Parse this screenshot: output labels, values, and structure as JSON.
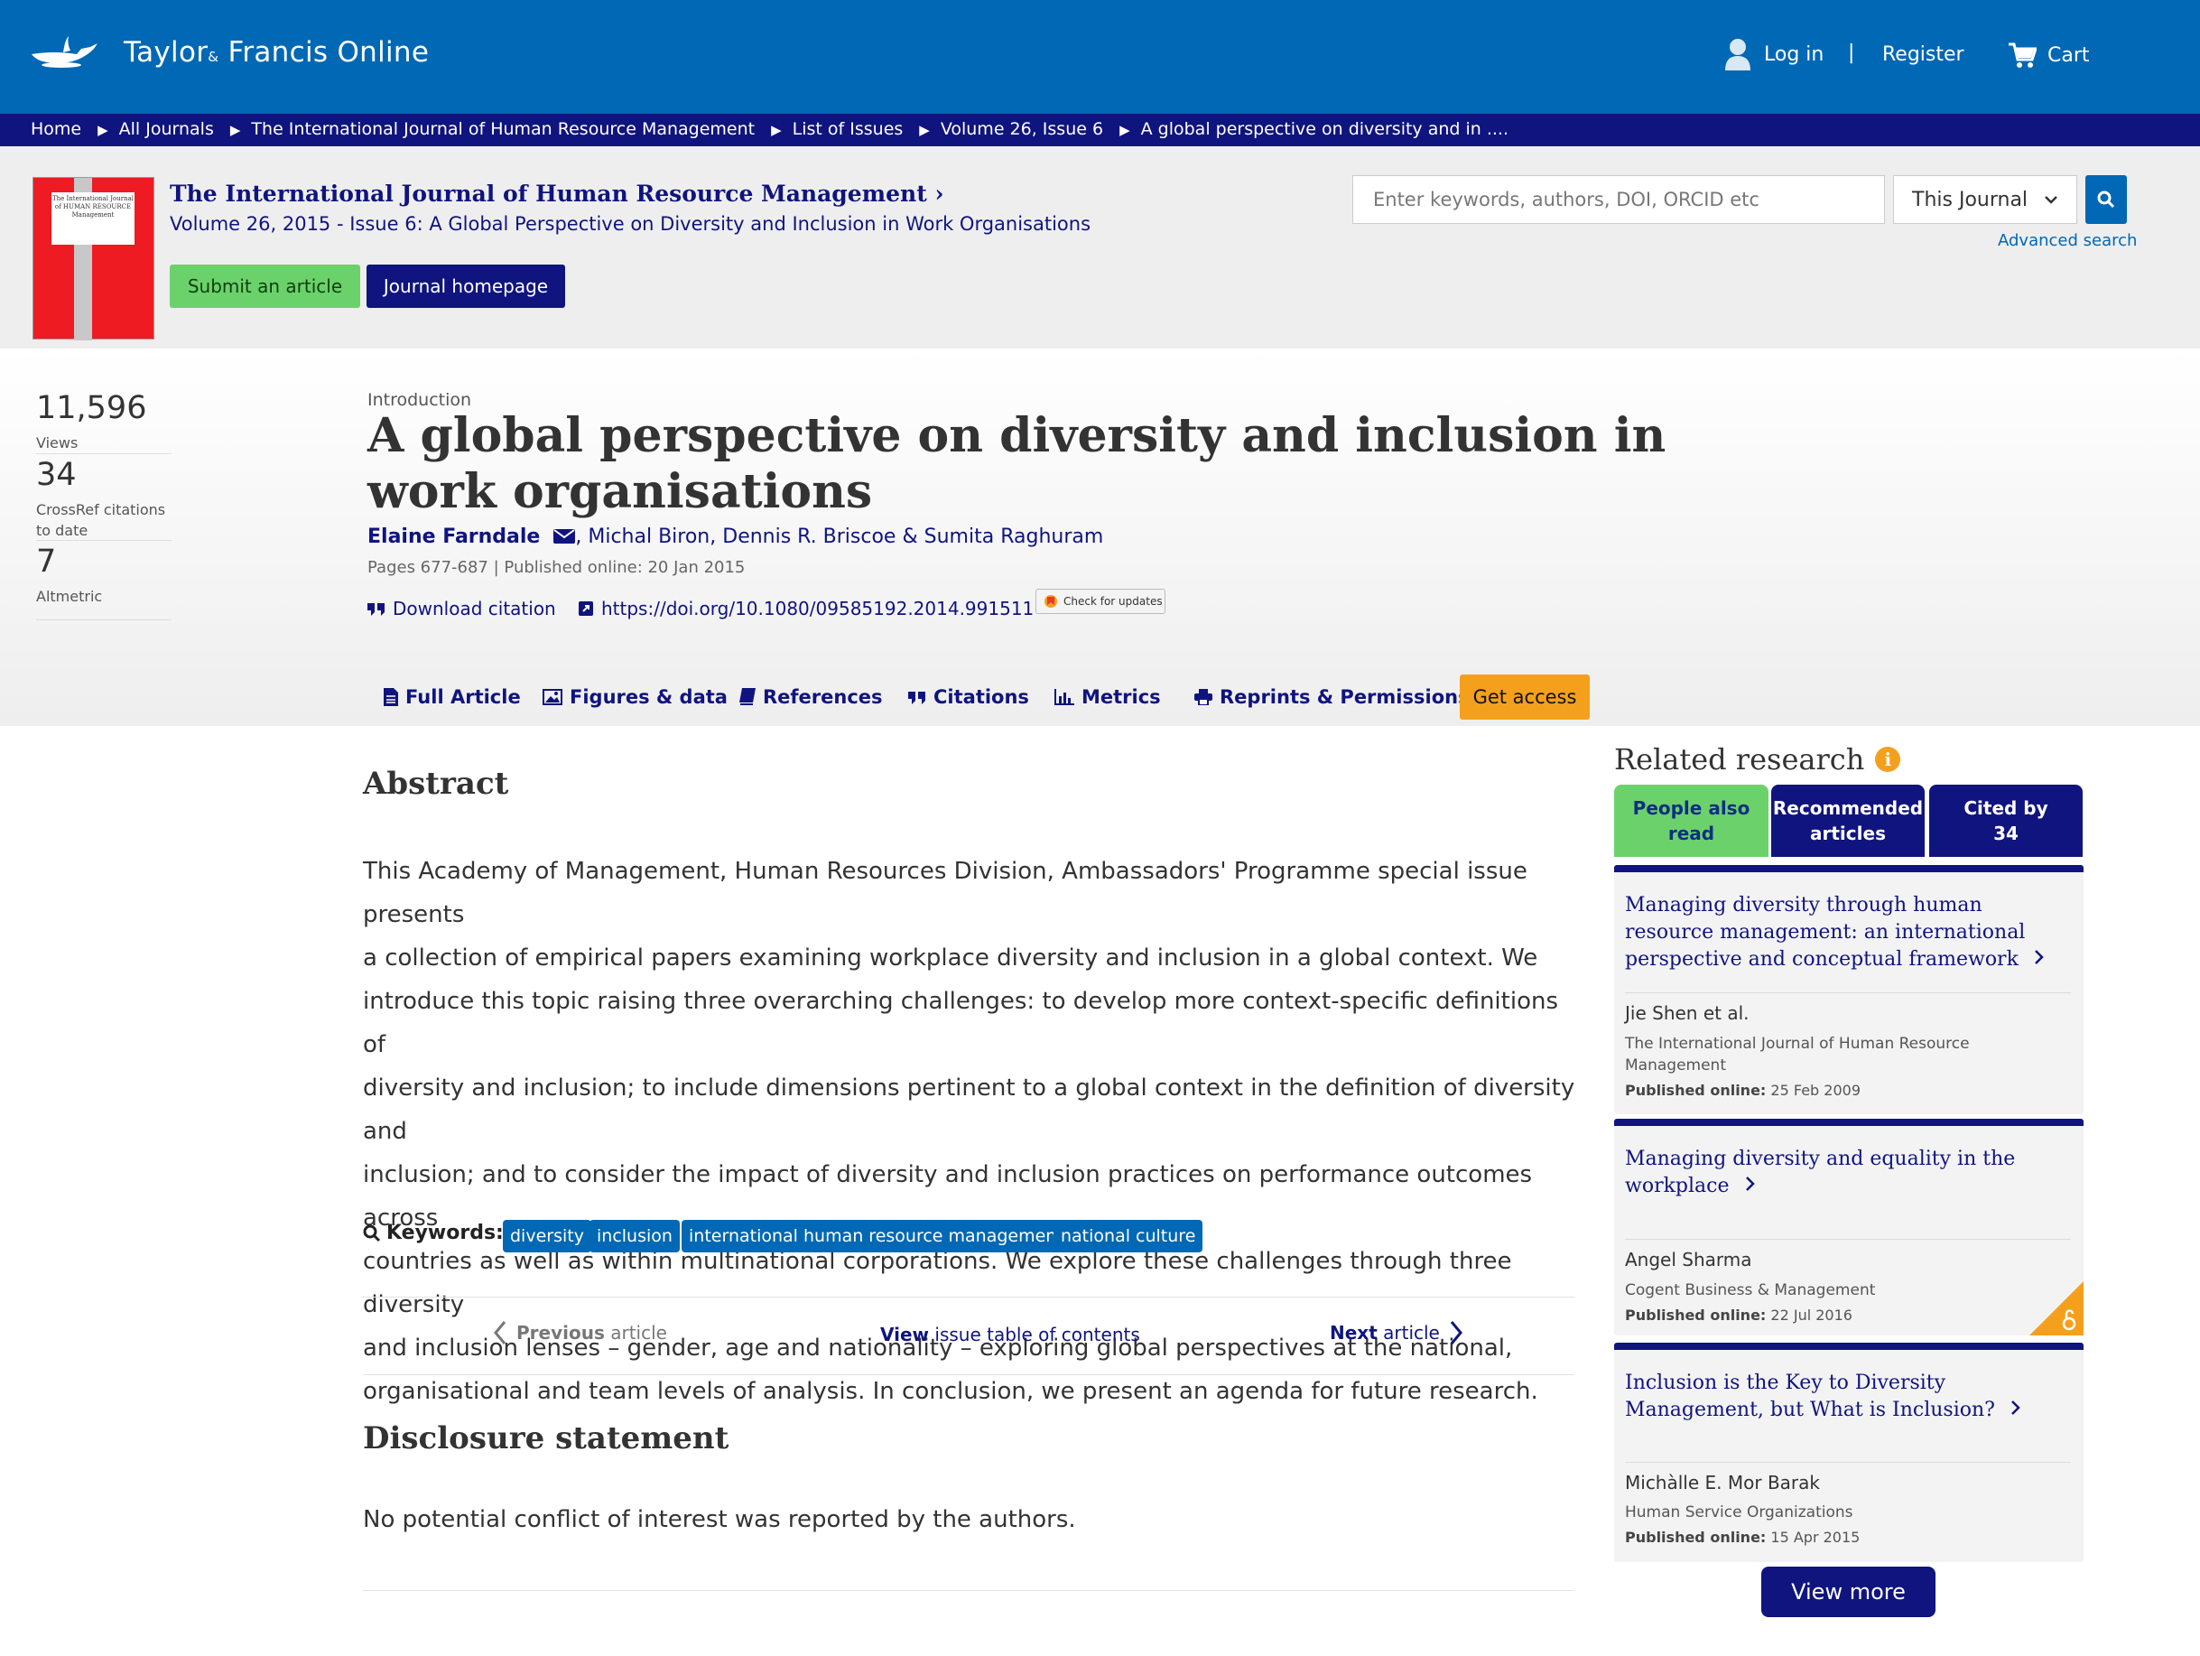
{
  "header": {
    "logo_text": "Taylor",
    "logo_amp": "&",
    "logo_text2": "Francis Online",
    "login": "Log in",
    "divider": "|",
    "register": "Register",
    "cart": "Cart"
  },
  "breadcrumb": {
    "items": [
      "Home",
      "All Journals",
      "The International Journal of Human Resource Management",
      "List of Issues",
      "Volume 26, Issue 6",
      "A global perspective on diversity and in ...."
    ]
  },
  "journal": {
    "title": "The International Journal of Human Resource Management",
    "title_arrow": "›",
    "volume": "Volume 26, 2015 - ",
    "issue_link": "Issue 6: A Global Perspective on Diversity and Inclusion in Work Organisations",
    "submit_label": "Submit an article",
    "homepage_label": "Journal homepage",
    "cover_text": "The International Journal of HUMAN RESOURCE Management"
  },
  "search": {
    "placeholder": "Enter keywords, authors, DOI, ORCID etc",
    "scope": "This Journal",
    "advanced": "Advanced search"
  },
  "metrics": {
    "views_value": "11,596",
    "views_label": "Views",
    "citations_value": "34",
    "citations_label_1": "CrossRef citations",
    "citations_label_2": "to date",
    "altmetric_value": "7",
    "altmetric_label": "Altmetric"
  },
  "article": {
    "type": "Introduction",
    "title": "A global perspective on diversity and inclusion in work organisations",
    "author1": "Elaine Farndale",
    "author_sep1": ", ",
    "author2": "Michal Biron",
    "author_sep2": ", ",
    "author3": "Dennis R. Briscoe",
    "author_sep3": " & ",
    "author4": "Sumita Raghuram",
    "pages": "Pages 677-687",
    "pub_sep": " | ",
    "published": "Published online: 20 Jan 2015",
    "download_citation": "Download citation",
    "doi": "https://doi.org/10.1080/09585192.2014.991511",
    "check_updates": "Check for updates"
  },
  "tabs": {
    "full_article": "Full Article",
    "figures": "Figures & data",
    "references": "References",
    "citations": "Citations",
    "metrics": "Metrics",
    "reprints": "Reprints & Permissions",
    "get_access": "Get access"
  },
  "abstract": {
    "heading": "Abstract",
    "lines": [
      "This Academy of Management, Human Resources Division, Ambassadors' Programme special issue presents",
      "a collection of empirical papers examining workplace diversity and inclusion in a global context. We",
      "introduce this topic raising three overarching challenges: to develop more context-specific definitions of",
      "diversity and inclusion; to include dimensions pertinent to a global context in the definition of diversity and",
      "inclusion; and to consider the impact of diversity and inclusion practices on performance outcomes across",
      "countries as well as within multinational corporations. We explore these challenges through three diversity",
      "and inclusion lenses – gender, age and nationality – exploring global perspectives at the national,",
      "organisational and team levels of analysis. In conclusion, we present an agenda for future research."
    ],
    "keywords_label": "Keywords::",
    "keywords": [
      "diversity",
      "inclusion",
      "international human resource management",
      "national culture"
    ]
  },
  "article_nav": {
    "previous_bold": "Previous",
    "previous_rest": " article",
    "view_bold": "View",
    "view_rest": " issue table of contents",
    "next_bold": "Next",
    "next_rest": " article"
  },
  "disclosure": {
    "heading": "Disclosure statement",
    "text": "No potential conflict of interest was reported by the authors."
  },
  "related": {
    "heading": "Related research",
    "tab1": "People also read",
    "tab2": "Recommended articles",
    "tab3_line1": "Cited by",
    "tab3_line2": "34",
    "items": [
      {
        "title": "Managing diversity through human resource management: an international perspective and conceptual framework",
        "author": "Jie Shen et al.",
        "journal": "The International Journal of Human Resource Management",
        "published_label": "Published online:",
        "published": " 25 Feb 2009"
      },
      {
        "title": "Managing diversity and equality in the workplace",
        "author": "Angel Sharma",
        "journal": "Cogent Business & Management",
        "published_label": "Published online:",
        "published": " 22 Jul 2016"
      },
      {
        "title": "Inclusion is the Key to Diversity Management, but What is Inclusion?",
        "author": "Michàlle E. Mor Barak",
        "journal": "Human Service Organizations",
        "published_label": "Published online:",
        "published": " 15 Apr 2015"
      }
    ],
    "view_more": "View more"
  },
  "colors": {
    "header_blue": "#0068b4",
    "navy": "#10147e",
    "green": "#6bd26b",
    "orange": "#f5a01d"
  },
  "icons": [
    "lamp-logo-icon",
    "user-icon",
    "cart-icon",
    "search-icon",
    "envelope-icon",
    "quote-icon",
    "external-link-icon",
    "document-icon",
    "image-icon",
    "book-icon",
    "bar-chart-icon",
    "print-icon",
    "info-icon",
    "chevron-left-icon",
    "chevron-right-icon",
    "open-access-icon"
  ]
}
